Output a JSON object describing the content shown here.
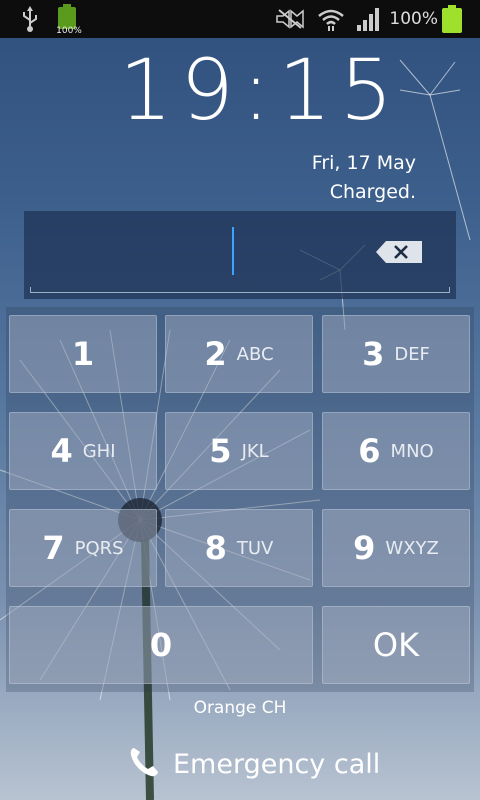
{
  "status_bar": {
    "left_icons": [
      "usb-icon",
      "battery-charging-icon"
    ],
    "small_battery_text": "100%",
    "right_icons": [
      "mute-icon",
      "wifi-icon",
      "signal-icon",
      "battery-icon"
    ],
    "battery_text": "100%"
  },
  "lockscreen": {
    "time": "19:15",
    "date": "Fri, 17 May",
    "charging_status": "Charged."
  },
  "pin_entry": {
    "value": "",
    "backspace_icon": "backspace-icon"
  },
  "keypad": {
    "keys": [
      {
        "digit": "1",
        "letters": ""
      },
      {
        "digit": "2",
        "letters": "ABC"
      },
      {
        "digit": "3",
        "letters": "DEF"
      },
      {
        "digit": "4",
        "letters": "GHI"
      },
      {
        "digit": "5",
        "letters": "JKL"
      },
      {
        "digit": "6",
        "letters": "MNO"
      },
      {
        "digit": "7",
        "letters": "PQRS"
      },
      {
        "digit": "8",
        "letters": "TUV"
      },
      {
        "digit": "9",
        "letters": "WXYZ"
      },
      {
        "digit": "0",
        "letters": ""
      }
    ],
    "ok_label": "OK"
  },
  "footer": {
    "carrier": "Orange CH",
    "emergency_label": "Emergency call",
    "emergency_icon": "phone-icon"
  },
  "colors": {
    "cursor": "#3ea3ff",
    "battery": "#9fe02c"
  }
}
